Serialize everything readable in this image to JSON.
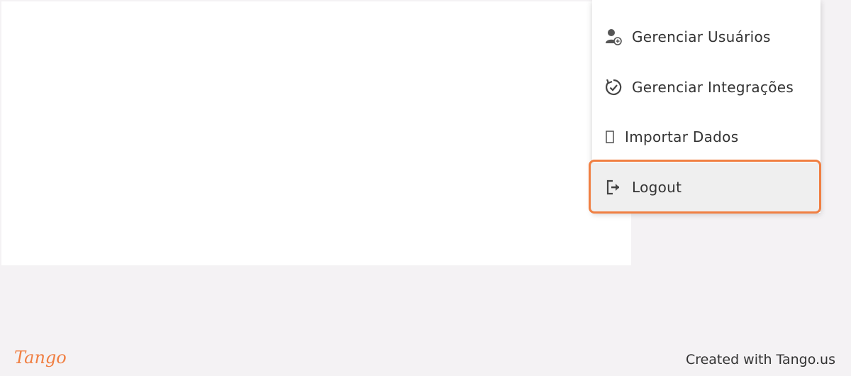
{
  "menu": {
    "items": [
      {
        "label": "Gerenciar Usuários",
        "icon": "manage-users-icon"
      },
      {
        "label": "Gerenciar Integrações",
        "icon": "integrations-sync-icon"
      },
      {
        "label": "Importar Dados",
        "icon": "import-placeholder-icon"
      },
      {
        "label": "Logout",
        "icon": "logout-icon"
      }
    ]
  },
  "footer": {
    "brand": "Tango",
    "credit": "Created with Tango.us"
  },
  "colors": {
    "highlight": "#f07f42",
    "brand": "#f07f42",
    "text": "#333333",
    "hover_bg": "#efefef"
  }
}
